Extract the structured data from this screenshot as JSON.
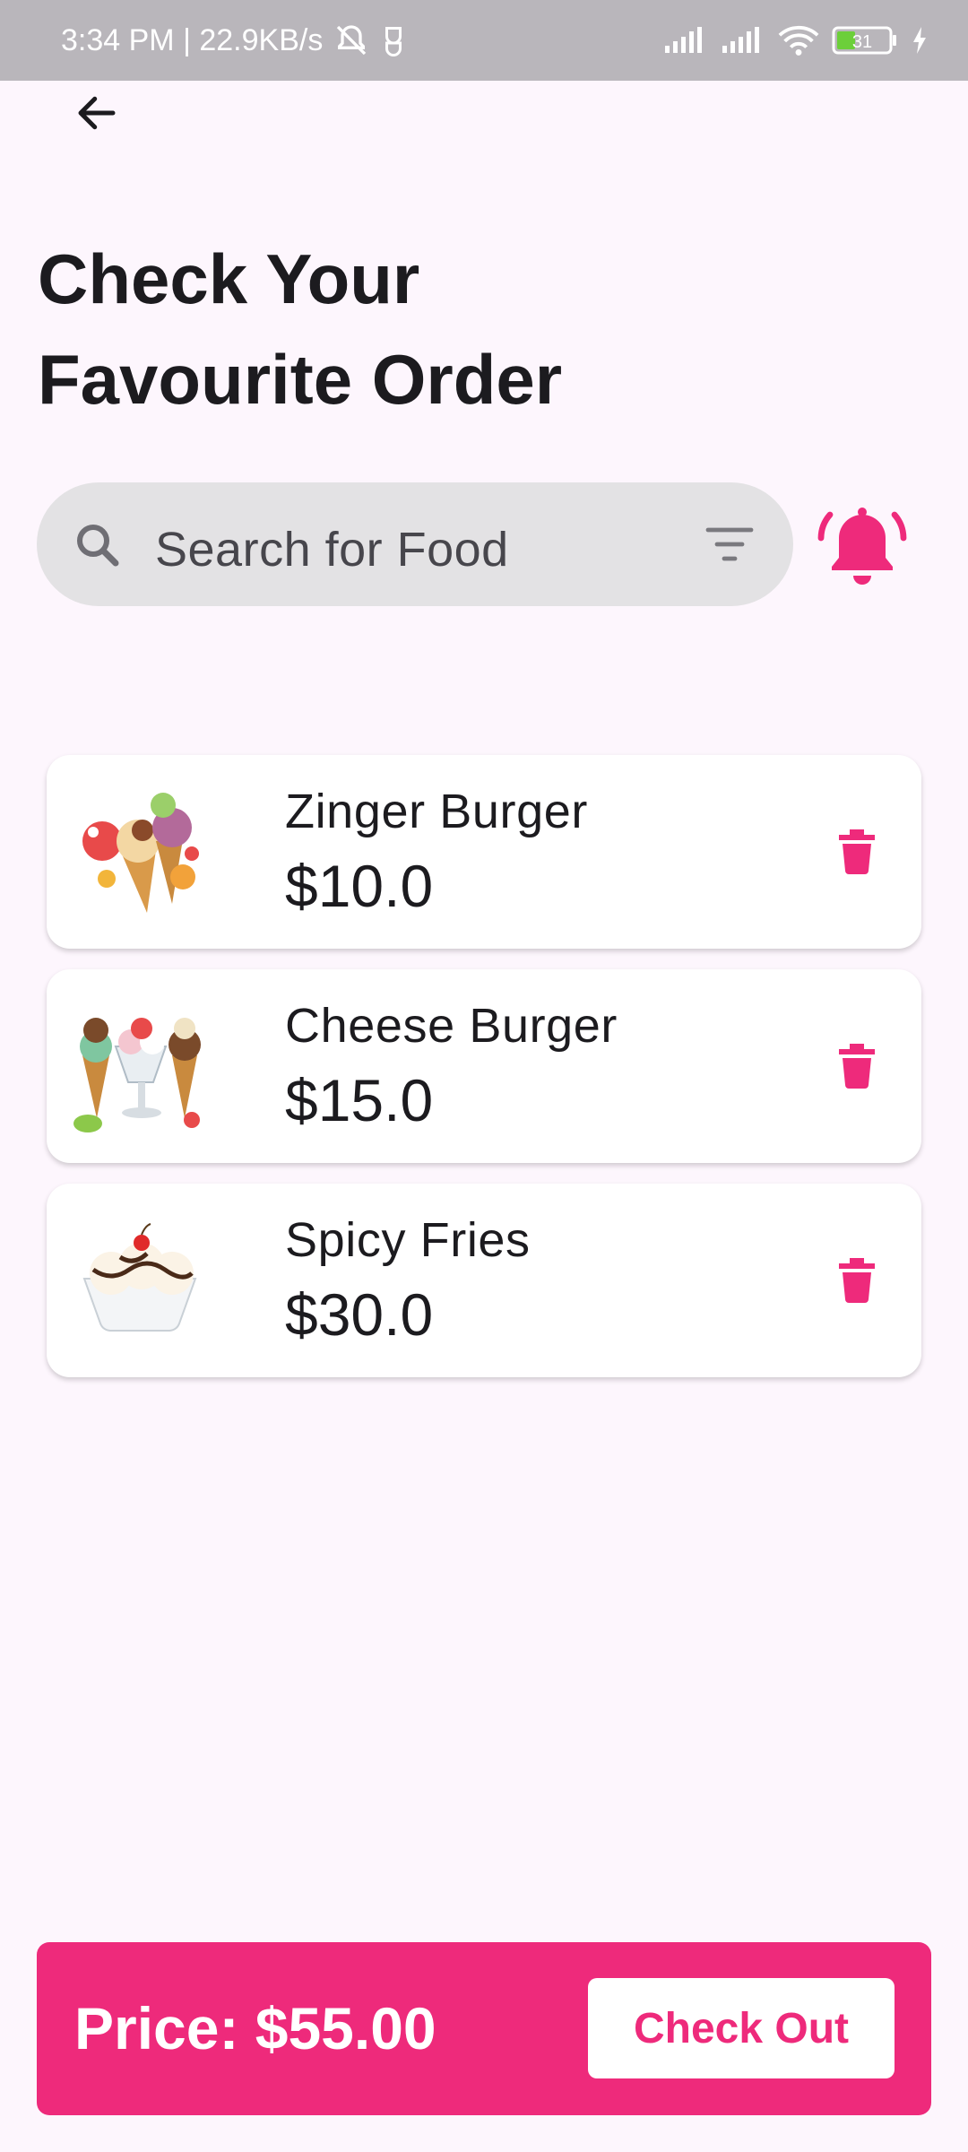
{
  "status_bar": {
    "time_info": "3:34 PM | 22.9KB/s",
    "battery_level": "31",
    "icons": [
      "mute-icon",
      "vpn-icon",
      "signal-icon",
      "signal-icon",
      "wifi-icon",
      "battery-icon",
      "charging-icon"
    ]
  },
  "header": {
    "back_icon": "arrow-left-icon",
    "title_line1": "Check Your",
    "title_line2": "Favourite Order"
  },
  "search": {
    "placeholder": "Search for Food",
    "icon": "search-icon",
    "filter_icon": "filter-icon"
  },
  "notification": {
    "icon": "bell-icon",
    "color": "#ee2a7b"
  },
  "cart": {
    "items": [
      {
        "name": "Zinger Burger",
        "price": "$10.0",
        "thumb": "ice-cream-cones-image"
      },
      {
        "name": "Cheese Burger",
        "price": "$15.0",
        "thumb": "ice-cream-sundae-image"
      },
      {
        "name": "Spicy Fries",
        "price": "$30.0",
        "thumb": "ice-cream-bowl-image"
      }
    ],
    "delete_icon": "trash-icon"
  },
  "footer": {
    "total_label": "Price: $55.00",
    "checkout_label": "Check Out"
  },
  "colors": {
    "accent": "#ee2a7b",
    "background": "#fdf6fd",
    "status_bar": "#b9b6bb",
    "search_bg": "#e3e2e4"
  }
}
